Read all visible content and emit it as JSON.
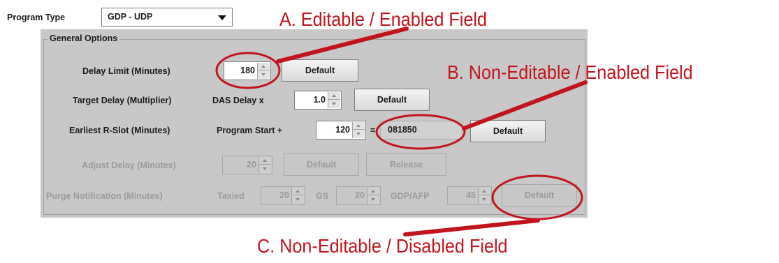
{
  "program_type": {
    "label": "Program Type",
    "value": "GDP - UDP"
  },
  "general_options": {
    "title": "General Options",
    "rows": {
      "delay_limit": {
        "label": "Delay Limit (Minutes)",
        "value": "180",
        "button": "Default"
      },
      "target_delay": {
        "label": "Target Delay (Multiplier)",
        "prefix": "DAS Delay x",
        "value": "1.0",
        "button": "Default"
      },
      "earliest_rslot": {
        "label": "Earliest R-Slot (Minutes)",
        "prefix": "Program Start +",
        "value": "120",
        "equals": "=",
        "computed": "081850",
        "button": "Default"
      },
      "adjust_delay": {
        "label": "Adjust Delay (Minutes)",
        "value": "20",
        "button": "Default",
        "button2": "Release"
      },
      "purge_notification": {
        "label": "Purge Notification (Minutes)",
        "taxied_label": "Taxied",
        "taxied_value": "20",
        "gs_label": "GS",
        "gs_value": "20",
        "gdpafp_label": "GDP/AFP",
        "gdpafp_value": "45",
        "button": "Default"
      }
    }
  },
  "annotations": {
    "a": "A. Editable / Enabled Field",
    "b": "B. Non-Editable / Enabled Field",
    "c": "C. Non-Editable / Disabled Field"
  },
  "colors": {
    "annotation": "#c2141b",
    "panel": "#c8c8c8"
  }
}
